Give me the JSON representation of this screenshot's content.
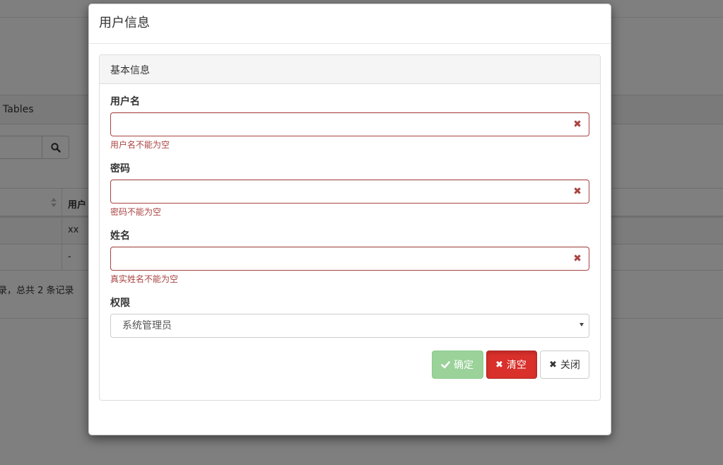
{
  "background": {
    "panel_title": "Tables",
    "table": {
      "header_col2": "用户",
      "rows": [
        {
          "col2": "xx"
        },
        {
          "col2": "-"
        }
      ]
    },
    "footer_info": "录，总共 2 条记录"
  },
  "modal": {
    "title": "用户信息",
    "panel_heading": "基本信息",
    "fields": {
      "username": {
        "label": "用户名",
        "value": "",
        "error": "用户名不能为空"
      },
      "password": {
        "label": "密码",
        "value": "",
        "error": "密码不能为空"
      },
      "realname": {
        "label": "姓名",
        "value": "",
        "error": "真实姓名不能为空"
      }
    },
    "permission": {
      "label": "权限",
      "selected": "系统管理员"
    },
    "buttons": {
      "confirm": "确定",
      "clear": "清空",
      "close": "关闭"
    }
  },
  "icons": {
    "error": "times-icon",
    "confirm": "check-icon",
    "clear": "times-icon",
    "close": "times-icon",
    "search": "search-icon"
  },
  "colors": {
    "error": "#a94442",
    "success_button": "#9ad29a",
    "danger_button": "#d9302b",
    "backdrop": "rgba(0,0,0,0.5)"
  }
}
